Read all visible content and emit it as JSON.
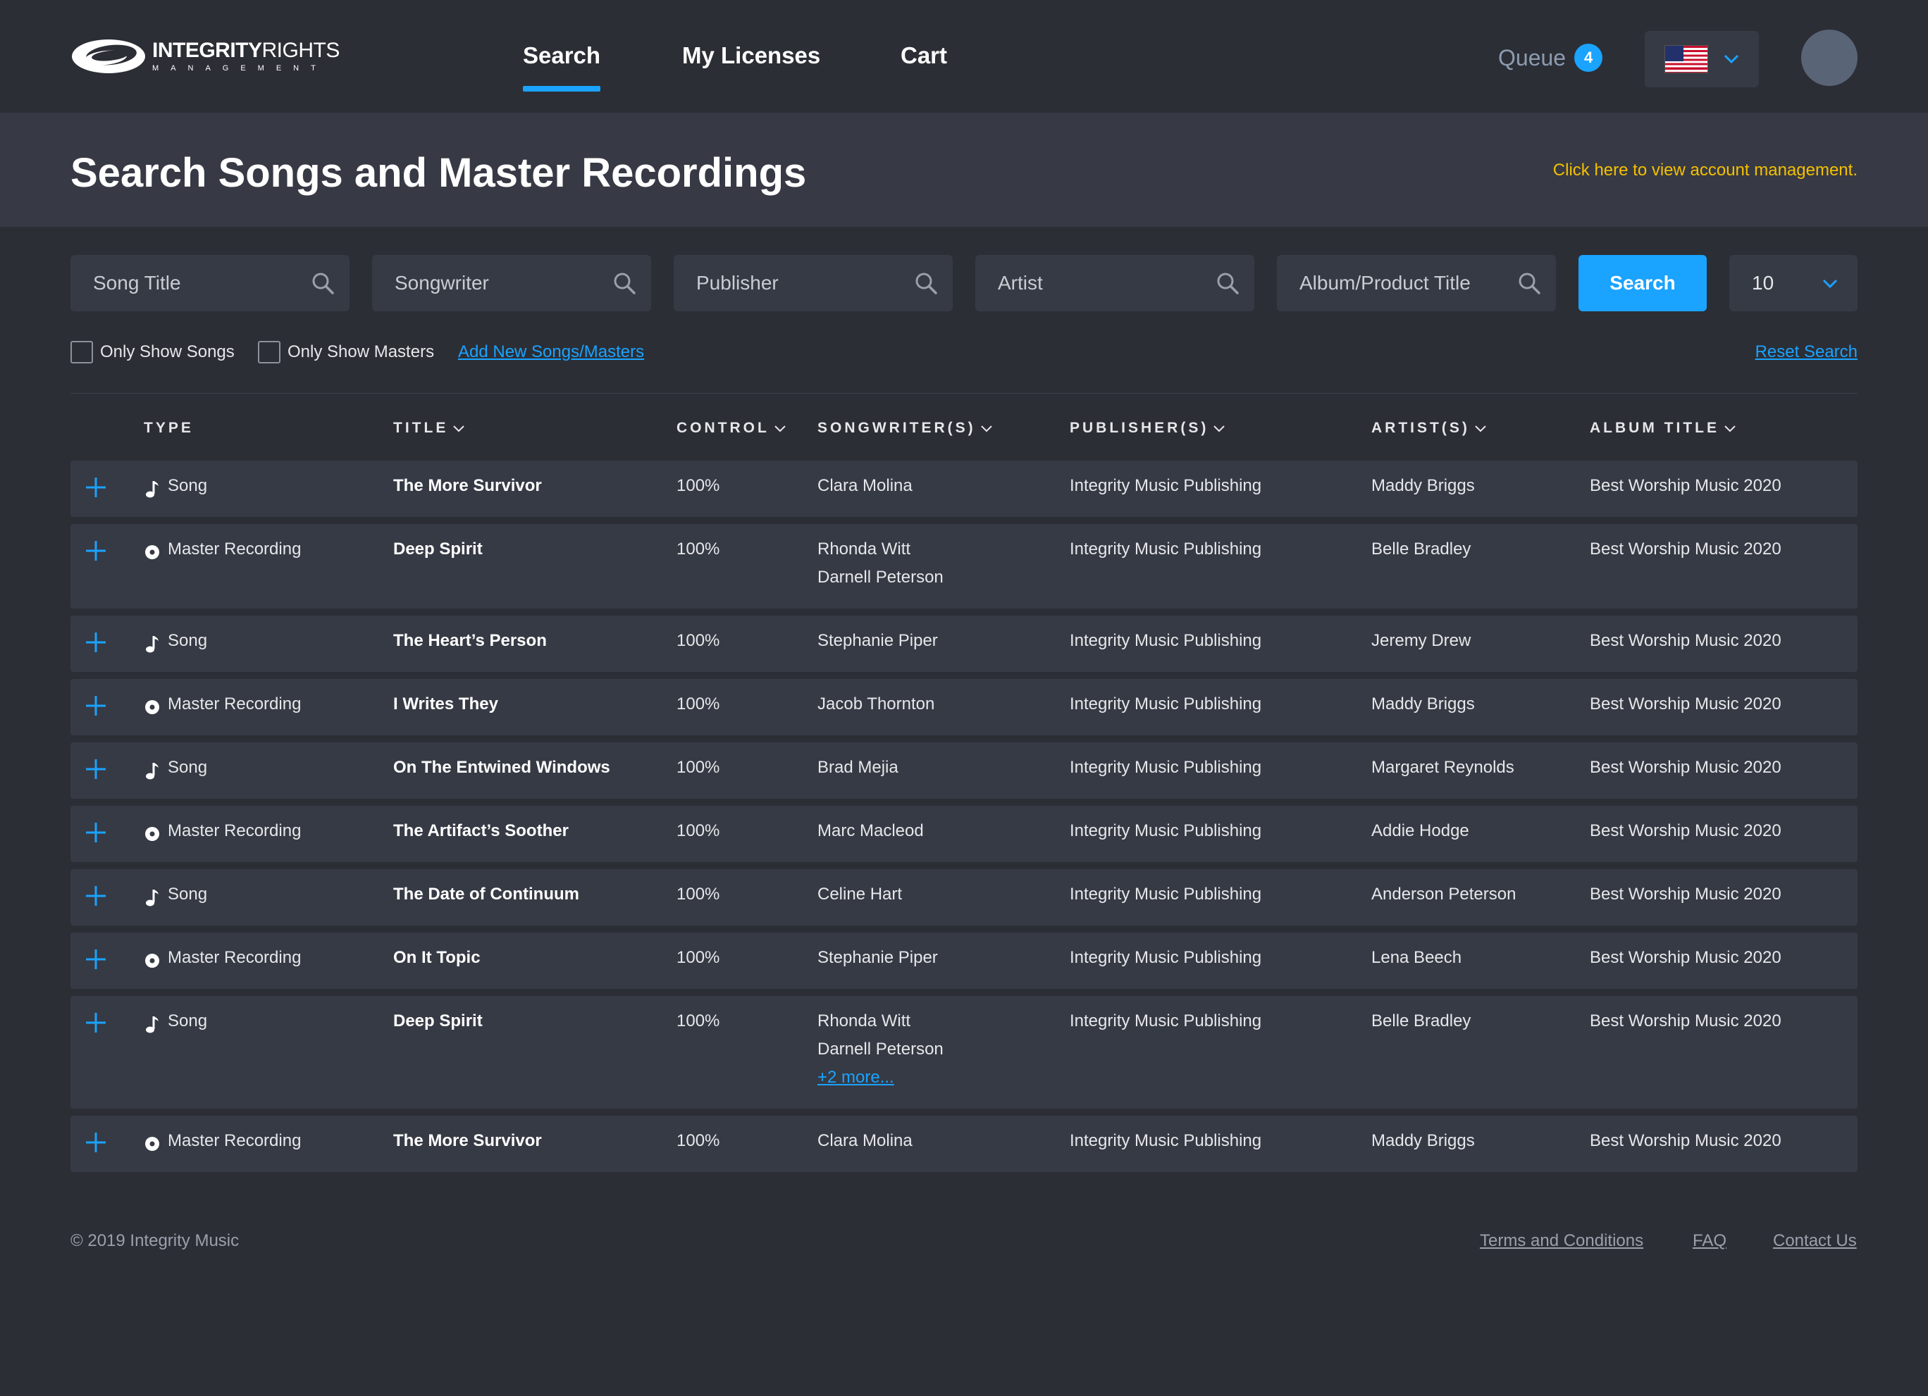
{
  "brand": {
    "logo_main_bold": "INTEGRITY",
    "logo_main_light": "RIGHTS",
    "logo_sub": "MANAGEMENT"
  },
  "nav": {
    "items": [
      {
        "label": "Search",
        "active": true
      },
      {
        "label": "My Licenses",
        "active": false
      },
      {
        "label": "Cart",
        "active": false
      }
    ],
    "queue_label": "Queue",
    "queue_count": "4",
    "locale_flag": "us-flag-icon"
  },
  "header": {
    "title": "Search Songs and Master Recordings",
    "account_link": "Click here to view account management."
  },
  "search": {
    "fields": [
      {
        "placeholder": "Song Title",
        "value": ""
      },
      {
        "placeholder": "Songwriter",
        "value": ""
      },
      {
        "placeholder": "Publisher",
        "value": ""
      },
      {
        "placeholder": "Artist",
        "value": ""
      },
      {
        "placeholder": "Album/Product Title",
        "value": ""
      }
    ],
    "button_label": "Search",
    "page_size": "10"
  },
  "filters": {
    "only_songs_label": "Only Show Songs",
    "only_songs_checked": false,
    "only_masters_label": "Only Show Masters",
    "only_masters_checked": false,
    "add_link": "Add New Songs/Masters",
    "reset_link": "Reset Search"
  },
  "table": {
    "columns": [
      "TYPE",
      "TITLE",
      "CONTROL",
      "SONGWRITER(S)",
      "PUBLISHER(S)",
      "ARTIST(S)",
      "ALBUM TITLE"
    ],
    "rows": [
      {
        "type": "Song",
        "icon": "music-note-icon",
        "title": "The More Survivor",
        "control": "100%",
        "songwriters": [
          "Clara Molina"
        ],
        "more": "",
        "publisher": "Integrity Music Publishing",
        "artist": "Maddy Briggs",
        "album": "Best Worship Music 2020"
      },
      {
        "type": "Master Recording",
        "icon": "record-icon",
        "title": "Deep Spirit",
        "control": "100%",
        "songwriters": [
          "Rhonda Witt",
          "Darnell Peterson"
        ],
        "more": "",
        "publisher": "Integrity Music Publishing",
        "artist": "Belle Bradley",
        "album": "Best Worship Music 2020"
      },
      {
        "type": "Song",
        "icon": "music-note-icon",
        "title": "The Heart’s Person",
        "control": "100%",
        "songwriters": [
          "Stephanie Piper"
        ],
        "more": "",
        "publisher": "Integrity Music Publishing",
        "artist": "Jeremy Drew",
        "album": "Best Worship Music 2020"
      },
      {
        "type": "Master Recording",
        "icon": "record-icon",
        "title": "I Writes They",
        "control": "100%",
        "songwriters": [
          "Jacob Thornton"
        ],
        "more": "",
        "publisher": "Integrity Music Publishing",
        "artist": "Maddy Briggs",
        "album": "Best Worship Music 2020"
      },
      {
        "type": "Song",
        "icon": "music-note-icon",
        "title": "On The Entwined Windows",
        "control": "100%",
        "songwriters": [
          "Brad Mejia"
        ],
        "more": "",
        "publisher": "Integrity Music Publishing",
        "artist": "Margaret Reynolds",
        "album": "Best Worship Music 2020"
      },
      {
        "type": "Master Recording",
        "icon": "record-icon",
        "title": "The Artifact’s Soother",
        "control": "100%",
        "songwriters": [
          "Marc Macleod"
        ],
        "more": "",
        "publisher": "Integrity Music Publishing",
        "artist": "Addie Hodge",
        "album": "Best Worship Music 2020"
      },
      {
        "type": "Song",
        "icon": "music-note-icon",
        "title": "The Date of Continuum",
        "control": "100%",
        "songwriters": [
          "Celine Hart"
        ],
        "more": "",
        "publisher": "Integrity Music Publishing",
        "artist": "Anderson Peterson",
        "album": "Best Worship Music 2020"
      },
      {
        "type": "Master Recording",
        "icon": "record-icon",
        "title": "On It Topic",
        "control": "100%",
        "songwriters": [
          "Stephanie Piper"
        ],
        "more": "",
        "publisher": "Integrity Music Publishing",
        "artist": "Lena Beech",
        "album": "Best Worship Music 2020"
      },
      {
        "type": "Song",
        "icon": "music-note-icon",
        "title": "Deep Spirit",
        "control": "100%",
        "songwriters": [
          "Rhonda Witt",
          "Darnell Peterson"
        ],
        "more": "+2 more...",
        "publisher": "Integrity Music Publishing",
        "artist": "Belle Bradley",
        "album": "Best Worship Music 2020"
      },
      {
        "type": "Master Recording",
        "icon": "record-icon",
        "title": "The More Survivor",
        "control": "100%",
        "songwriters": [
          "Clara Molina"
        ],
        "more": "",
        "publisher": "Integrity Music Publishing",
        "artist": "Maddy Briggs",
        "album": "Best Worship Music 2020"
      }
    ]
  },
  "footer": {
    "copyright": "© 2019 Integrity Music",
    "links": [
      "Terms and Conditions",
      "FAQ",
      "Contact Us"
    ]
  },
  "colors": {
    "background": "#2c2e35",
    "panel": "#363a44",
    "header_band": "#373a44",
    "accent": "#1aa3ff",
    "account_link": "#f5c000"
  }
}
